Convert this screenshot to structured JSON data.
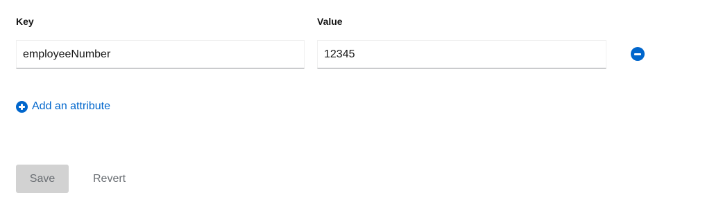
{
  "attributes": {
    "headers": {
      "key": "Key",
      "value": "Value"
    },
    "rows": [
      {
        "key": "employeeNumber",
        "value": "12345",
        "remove_icon": "minus-circle-icon"
      }
    ],
    "add_link": {
      "label": "Add an attribute",
      "icon": "plus-circle-icon"
    }
  },
  "actions": {
    "save_label": "Save",
    "save_disabled": true,
    "revert_label": "Revert"
  },
  "colors": {
    "accent": "#0066cc",
    "disabled_bg": "#d2d2d2",
    "muted_text": "#6a6e73"
  }
}
